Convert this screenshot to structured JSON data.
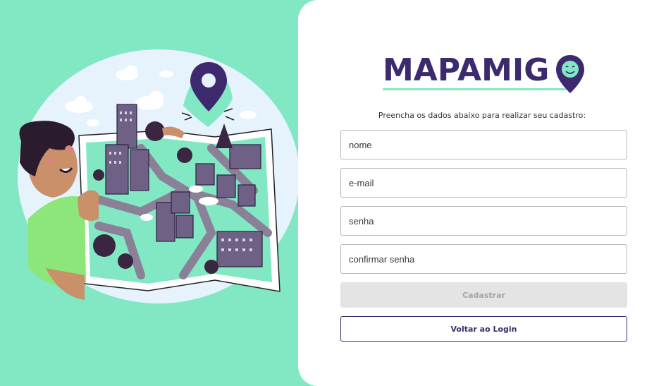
{
  "brand": {
    "logo_text": "MAPAMIG",
    "primary_color": "#3d2a6e",
    "accent_color": "#82e8c4"
  },
  "form": {
    "subtitle": "Preencha os dados abaixo para realizar seu cadastro:",
    "name_placeholder": "nome",
    "email_placeholder": "e-mail",
    "password_placeholder": "senha",
    "confirm_password_placeholder": "confirmar senha",
    "submit_label": "Cadastrar",
    "back_label": "Voltar ao Login"
  },
  "illustration": {
    "icon": "map-pin-icon"
  }
}
